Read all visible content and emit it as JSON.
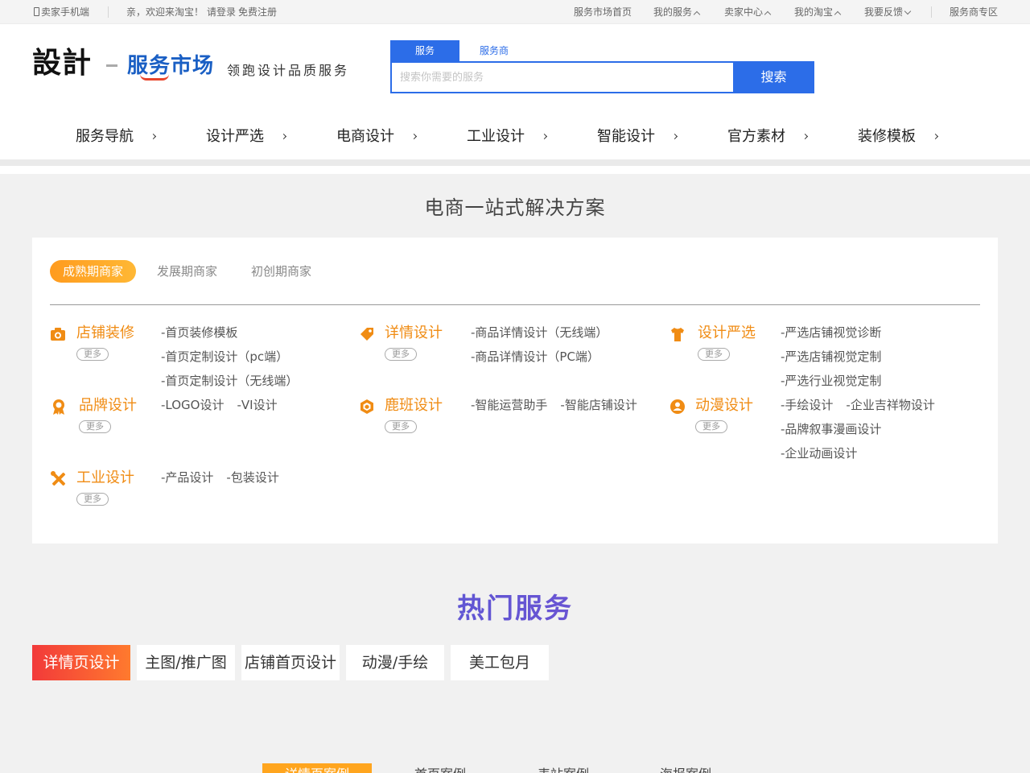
{
  "topbar": {
    "seller_mobile": "卖家手机端",
    "welcome": "亲，欢迎来淘宝！",
    "login": "请登录",
    "register": "免费注册",
    "market_home": "服务市场首页",
    "my_services": "我的服务",
    "seller_center": "卖家中心",
    "my_taobao": "我的淘宝",
    "feedback": "我要反馈",
    "provider_zone": "服务商专区"
  },
  "header": {
    "logo_main": "設計",
    "logo_market": "服务市场",
    "slogan": "领跑设计品质服务",
    "search": {
      "tab_service": "服务",
      "tab_provider": "服务商",
      "placeholder": "搜索你需要的服务",
      "button": "搜索"
    }
  },
  "nav": [
    "服务导航",
    "设计严选",
    "电商设计",
    "工业设计",
    "智能设计",
    "官方素材",
    "装修模板"
  ],
  "solutions": {
    "title": "电商一站式解决方案",
    "stages": [
      "成熟期商家",
      "发展期商家",
      "初创期商家"
    ],
    "more_label": "更多",
    "categories": [
      {
        "name": "店铺装修",
        "icon": "camera-icon",
        "links": [
          [
            "-首页装修模板"
          ],
          [
            "-首页定制设计（pc端）"
          ],
          [
            "-首页定制设计（无线端）"
          ]
        ]
      },
      {
        "name": "详情设计",
        "icon": "tag-icon",
        "links": [
          [
            "-商品详情设计（无线端）"
          ],
          [
            "-商品详情设计（PC端）"
          ]
        ]
      },
      {
        "name": "设计严选",
        "icon": "shirt-icon",
        "links": [
          [
            "-严选店铺视觉诊断"
          ],
          [
            "-严选店铺视觉定制"
          ],
          [
            "-严选行业视觉定制"
          ]
        ]
      },
      {
        "name": "品牌设计",
        "icon": "award-icon",
        "links": [
          [
            "-LOGO设计",
            "-VI设计"
          ]
        ]
      },
      {
        "name": "鹿班设计",
        "icon": "cube-icon",
        "links": [
          [
            "-智能运营助手",
            "-智能店铺设计"
          ]
        ]
      },
      {
        "name": "动漫设计",
        "icon": "user-icon",
        "links": [
          [
            "-手绘设计",
            "-企业吉祥物设计"
          ],
          [
            "-品牌叙事漫画设计"
          ],
          [
            "-企业动画设计"
          ]
        ]
      },
      {
        "name": "工业设计",
        "icon": "tools-icon",
        "links": [
          [
            "-产品设计",
            "-包装设计"
          ]
        ]
      }
    ]
  },
  "hot": {
    "title": "热门服务",
    "tabs": [
      "详情页设计",
      "主图/推广图",
      "店铺首页设计",
      "动漫/手绘",
      "美工包月"
    ],
    "case_tabs": [
      "详情页案例",
      "首页案例",
      "表站案例",
      "海报案例"
    ]
  },
  "colors": {
    "brand_blue": "#2c6de8",
    "accent_orange": "#f08c14",
    "hot_red": "#f23a3a"
  }
}
